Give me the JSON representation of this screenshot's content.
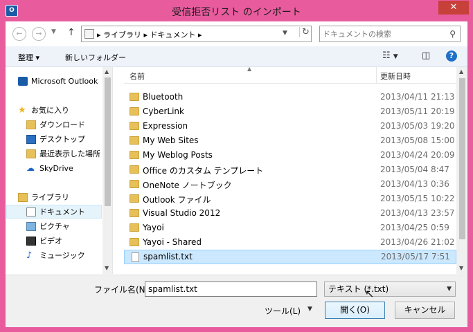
{
  "window": {
    "title": "受信拒否リスト のインポート",
    "app_icon": "O",
    "close_label": "✕"
  },
  "navbar": {
    "back_icon": "arrow-left-icon",
    "forward_icon": "arrow-right-icon",
    "up_icon": "arrow-up-icon",
    "address_path": "▸ ライブラリ ▸ ドキュメント ▸",
    "search_placeholder": "ドキュメントの検索"
  },
  "toolbar": {
    "organize_label": "整理 ▾",
    "new_folder_label": "新しいフォルダー",
    "view_icon": "view-list-icon",
    "preview_icon": "preview-pane-icon",
    "help_label": "?"
  },
  "navpane": {
    "items": [
      {
        "label": "Microsoft Outlook",
        "icon": "outlook-icon",
        "indent": 0
      },
      {
        "label": "お気に入り",
        "icon": "star-icon",
        "indent": 0
      },
      {
        "label": "ダウンロード",
        "icon": "download-folder-icon",
        "indent": 1
      },
      {
        "label": "デスクトップ",
        "icon": "desktop-icon",
        "indent": 1
      },
      {
        "label": "最近表示した場所",
        "icon": "recent-places-icon",
        "indent": 1
      },
      {
        "label": "SkyDrive",
        "icon": "skydrive-icon",
        "indent": 1
      },
      {
        "label": "ライブラリ",
        "icon": "library-icon",
        "indent": 0
      },
      {
        "label": "ドキュメント",
        "icon": "documents-icon",
        "indent": 1,
        "selected": true
      },
      {
        "label": "ピクチャ",
        "icon": "pictures-icon",
        "indent": 1
      },
      {
        "label": "ビデオ",
        "icon": "video-icon",
        "indent": 1
      },
      {
        "label": "ミュージック",
        "icon": "music-icon",
        "indent": 1
      }
    ]
  },
  "filelist": {
    "col_name": "名前",
    "col_date": "更新日時",
    "rows": [
      {
        "name": "Bluetooth",
        "date": "2013/04/11 21:13",
        "type": "folder"
      },
      {
        "name": "CyberLink",
        "date": "2013/05/11 20:19",
        "type": "folder"
      },
      {
        "name": "Expression",
        "date": "2013/05/03 19:20",
        "type": "folder"
      },
      {
        "name": "My Web Sites",
        "date": "2013/05/08 15:00",
        "type": "folder-web"
      },
      {
        "name": "My Weblog Posts",
        "date": "2013/04/24 20:09",
        "type": "folder"
      },
      {
        "name": "Office のカスタム テンプレート",
        "date": "2013/05/04 8:47",
        "type": "folder"
      },
      {
        "name": "OneNote ノートブック",
        "date": "2013/04/13 0:36",
        "type": "folder"
      },
      {
        "name": "Outlook ファイル",
        "date": "2013/05/15 10:22",
        "type": "folder"
      },
      {
        "name": "Visual Studio 2012",
        "date": "2013/04/13 23:57",
        "type": "folder"
      },
      {
        "name": "Yayoi",
        "date": "2013/04/25 0:59",
        "type": "folder"
      },
      {
        "name": "Yayoi - Shared",
        "date": "2013/04/26 21:02",
        "type": "folder"
      },
      {
        "name": "spamlist.txt",
        "date": "2013/05/17 7:51",
        "type": "txt",
        "selected": true
      }
    ]
  },
  "bottom": {
    "filename_label": "ファイル名(N):",
    "filename_value": "spamlist.txt",
    "filetype_value": "テキスト (*.txt)",
    "tools_label": "ツール(L)",
    "open_label": "開く(O)",
    "cancel_label": "キャンセル"
  }
}
